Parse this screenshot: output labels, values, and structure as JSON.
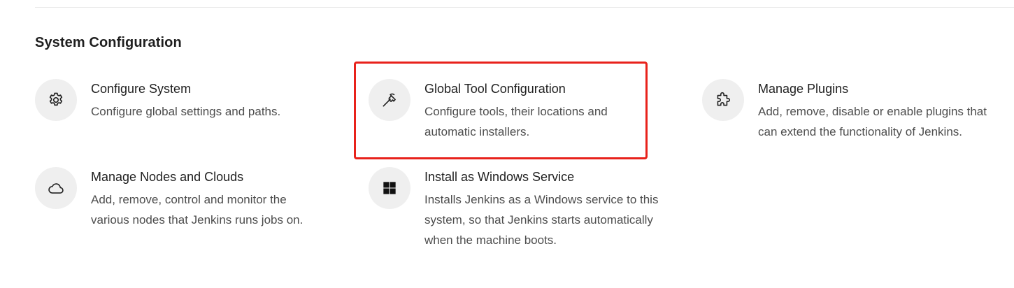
{
  "section": {
    "title": "System Configuration"
  },
  "items": [
    {
      "title": "Configure System",
      "description_lines": [
        "Configure global settings and paths."
      ],
      "icon": "gear-icon"
    },
    {
      "title": "Global Tool Configuration",
      "description_lines": [
        "Configure tools, their locations and",
        "automatic installers."
      ],
      "icon": "hammer-icon"
    },
    {
      "title": "Manage Plugins",
      "description_lines": [
        "Add, remove, disable or enable plugins that",
        "can extend the functionality of Jenkins."
      ],
      "icon": "puzzle-icon"
    },
    {
      "title": "Manage Nodes and Clouds",
      "description_lines": [
        "Add, remove, control and monitor the",
        "various nodes that Jenkins runs jobs on."
      ],
      "icon": "cloud-icon"
    },
    {
      "title": "Install as Windows Service",
      "description_lines": [
        "Installs Jenkins as a Windows service to this",
        "system, so that Jenkins starts automatically",
        "when the machine boots."
      ],
      "icon": "windows-icon"
    }
  ],
  "colors": {
    "highlight": "#e8221b",
    "icon_background": "#efefef"
  }
}
